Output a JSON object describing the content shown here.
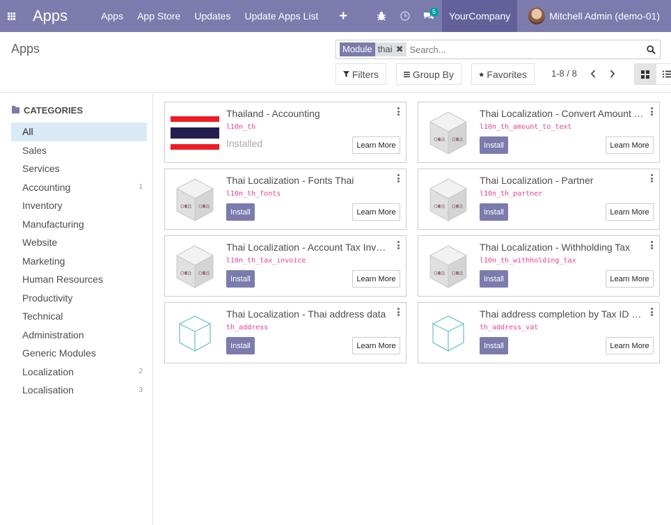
{
  "navbar": {
    "brand": "Apps",
    "menu": [
      "Apps",
      "App Store",
      "Updates",
      "Update Apps List"
    ],
    "plus_glyph": "+",
    "messages_count": "5",
    "company": "YourCompany",
    "user": "Mitchell Admin (demo-01)",
    "color": "#7c7bad"
  },
  "control": {
    "breadcrumb": "Apps",
    "facet_label": "Module",
    "facet_value": "thai",
    "search_placeholder": "Search...",
    "filters": "Filters",
    "group_by": "Group By",
    "favorites": "Favorites",
    "pager": "1-8 / 8"
  },
  "sidebar": {
    "header": "CATEGORIES",
    "items": [
      {
        "label": "All",
        "count": "",
        "active": true
      },
      {
        "label": "Sales",
        "count": ""
      },
      {
        "label": "Services",
        "count": ""
      },
      {
        "label": "Accounting",
        "count": "1"
      },
      {
        "label": "Inventory",
        "count": ""
      },
      {
        "label": "Manufacturing",
        "count": ""
      },
      {
        "label": "Website",
        "count": ""
      },
      {
        "label": "Marketing",
        "count": ""
      },
      {
        "label": "Human Resources",
        "count": ""
      },
      {
        "label": "Productivity",
        "count": ""
      },
      {
        "label": "Technical",
        "count": ""
      },
      {
        "label": "Administration",
        "count": ""
      },
      {
        "label": "Generic Modules",
        "count": ""
      },
      {
        "label": "Localization",
        "count": "2"
      },
      {
        "label": "Localisation",
        "count": "3"
      }
    ]
  },
  "apps": [
    {
      "title": "Thailand - Accounting",
      "tech": "l10n_th",
      "status": "Installed",
      "icon": "thailand-flag-icon"
    },
    {
      "title": "Thai Localization - Convert Amount To Text",
      "tech": "l10n_th_amount_to_text",
      "install": "Install",
      "icon": "oca-module-icon"
    },
    {
      "title": "Thai Localization - Fonts Thai",
      "tech": "l10n_th_fonts",
      "install": "Install",
      "icon": "oca-module-icon"
    },
    {
      "title": "Thai Localization - Partner",
      "tech": "l10n_th_partner",
      "install": "Install",
      "icon": "oca-module-icon"
    },
    {
      "title": "Thai Localization - Account Tax Invoice",
      "tech": "l10n_th_tax_invoice",
      "install": "Install",
      "icon": "oca-module-icon"
    },
    {
      "title": "Thai Localization - Withholding Tax",
      "tech": "l10n_th_withholding_tax",
      "install": "Install",
      "icon": "oca-module-icon"
    },
    {
      "title": "Thai Localization - Thai address data",
      "tech": "th_address",
      "install": "Install",
      "icon": "generic-cube-icon"
    },
    {
      "title": "Thai address completion by Tax ID (VAT)",
      "tech": "th_address_vat",
      "install": "Install",
      "icon": "generic-cube-icon"
    }
  ],
  "learn_more": "Learn More"
}
